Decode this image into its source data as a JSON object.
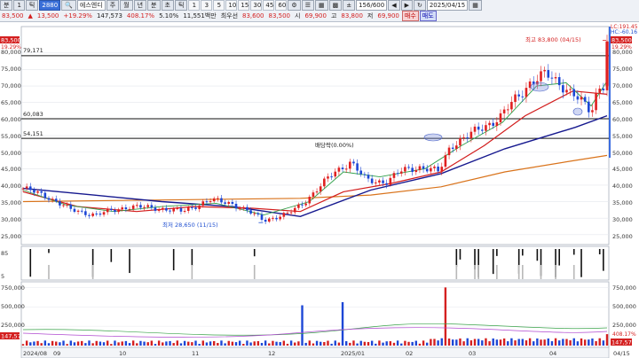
{
  "toolbar": {
    "top": {
      "period_mode": "분",
      "interval": "1",
      "unit": "틱",
      "code": "2880",
      "name": "에스엔디",
      "tabs": [
        "주",
        "월",
        "년",
        "분",
        "초",
        "틱"
      ],
      "numbers": [
        "1",
        "3",
        "5",
        "10",
        "15",
        "30",
        "45",
        "60"
      ],
      "count": "156/600",
      "date": "2025/04/15"
    },
    "quote": {
      "price": "83,500",
      "change": "13,500",
      "change_pct": "+19.29%",
      "volume": "147,573",
      "vol_ratio": "408.17%",
      "turnover": "5.10%",
      "amount": "11,551백만",
      "high_label": "최우선",
      "bid": "83,600",
      "ask": "83,500",
      "open_label": "시",
      "open": "69,900",
      "hi_label": "고",
      "high": "83,800",
      "lo_label": "저",
      "low": "69,900",
      "buy": "매수",
      "sell": "매도"
    }
  },
  "price_axis": {
    "labels": [
      "80,000",
      "75,000",
      "70,000",
      "65,000",
      "60,000",
      "55,000",
      "50,000",
      "45,000",
      "40,000",
      "35,000",
      "30,000",
      "25,000"
    ],
    "left_current": "83,500",
    "left_pct": "19.29%",
    "right_current": "83,500",
    "right_pct": "19.29%",
    "lc_label": "LC:191.45",
    "hc_label": "HC:-60.16"
  },
  "levels": [
    {
      "price": 79171,
      "label": "79,171"
    },
    {
      "price": 60083,
      "label": "60,083"
    },
    {
      "price": 54151,
      "label": "54,151"
    }
  ],
  "annotations": {
    "high": "최고 83,800 (04/15)",
    "low": "최저 28,650 (11/15)",
    "ex_div": "배당락(0.00%)"
  },
  "signal_axis": {
    "labels": [
      "85",
      "5"
    ]
  },
  "volume_axis": {
    "left_labels": [
      "750,000",
      "500,000",
      "250,000",
      "147,573"
    ],
    "right_labels": [
      "750,000",
      "500,000",
      "250,000",
      "408.17%",
      "147,573"
    ]
  },
  "date_axis": [
    "2024/08",
    "09",
    "10",
    "11",
    "12",
    "2025/01",
    "02",
    "03",
    "04",
    "04/15"
  ],
  "chart_data": {
    "type": "candlestick",
    "title": "",
    "xlabel": "",
    "ylabel": "",
    "ylim": [
      22000,
      88000
    ],
    "volume_ylim": [
      0,
      800000
    ],
    "x_range": [
      "2024-08-01",
      "2025-04-15"
    ],
    "current": 83500,
    "high": {
      "date": "2025-04-15",
      "value": 83800
    },
    "low": {
      "date": "2024-11-15",
      "value": 28650
    },
    "close_path": [
      [
        "2024-08-01",
        39000
      ],
      [
        "2024-08-12",
        36500
      ],
      [
        "2024-08-22",
        32500
      ],
      [
        "2024-09-02",
        31000
      ],
      [
        "2024-09-16",
        33500
      ],
      [
        "2024-09-30",
        33000
      ],
      [
        "2024-10-10",
        32000
      ],
      [
        "2024-10-22",
        35500
      ],
      [
        "2024-11-01",
        34500
      ],
      [
        "2024-11-08",
        32000
      ],
      [
        "2024-11-15",
        29500
      ],
      [
        "2024-11-25",
        31000
      ],
      [
        "2024-12-02",
        34500
      ],
      [
        "2024-12-09",
        39000
      ],
      [
        "2024-12-16",
        44000
      ],
      [
        "2024-12-23",
        47000
      ],
      [
        "2024-12-30",
        41500
      ],
      [
        "2025-01-08",
        41000
      ],
      [
        "2025-01-15",
        44500
      ],
      [
        "2025-01-22",
        45500
      ],
      [
        "2025-01-31",
        44000
      ],
      [
        "2025-02-05",
        52000
      ],
      [
        "2025-02-12",
        54500
      ],
      [
        "2025-02-19",
        57500
      ],
      [
        "2025-02-27",
        60500
      ],
      [
        "2025-03-05",
        65500
      ],
      [
        "2025-03-12",
        71000
      ],
      [
        "2025-03-19",
        73500
      ],
      [
        "2025-03-26",
        70500
      ],
      [
        "2025-04-01",
        67000
      ],
      [
        "2025-04-08",
        62000
      ],
      [
        "2025-04-11",
        69500
      ],
      [
        "2025-04-14",
        71000
      ],
      [
        "2025-04-15",
        83500
      ]
    ],
    "ma_fast": [
      [
        "2024-08-01",
        38500
      ],
      [
        "2024-08-20",
        34000
      ],
      [
        "2024-09-10",
        32000
      ],
      [
        "2024-10-01",
        33500
      ],
      [
        "2024-10-25",
        34500
      ],
      [
        "2024-11-15",
        31000
      ],
      [
        "2024-12-05",
        35000
      ],
      [
        "2024-12-20",
        44000
      ],
      [
        "2025-01-05",
        42500
      ],
      [
        "2025-01-25",
        45000
      ],
      [
        "2025-02-10",
        52000
      ],
      [
        "2025-02-28",
        59000
      ],
      [
        "2025-03-15",
        70000
      ],
      [
        "2025-03-28",
        71000
      ],
      [
        "2025-04-08",
        64000
      ],
      [
        "2025-04-15",
        71500
      ]
    ],
    "ma_mid": [
      [
        "2024-08-01",
        38000
      ],
      [
        "2024-08-25",
        33500
      ],
      [
        "2024-09-20",
        32000
      ],
      [
        "2024-10-15",
        33500
      ],
      [
        "2024-11-10",
        33000
      ],
      [
        "2024-12-01",
        32000
      ],
      [
        "2024-12-20",
        38000
      ],
      [
        "2025-01-10",
        40500
      ],
      [
        "2025-02-01",
        44000
      ],
      [
        "2025-02-20",
        52000
      ],
      [
        "2025-03-10",
        61000
      ],
      [
        "2025-03-31",
        68500
      ],
      [
        "2025-04-15",
        67500
      ]
    ],
    "ma_slow": [
      [
        "2024-08-01",
        39000
      ],
      [
        "2024-09-01",
        37000
      ],
      [
        "2024-10-01",
        35000
      ],
      [
        "2024-11-01",
        33500
      ],
      [
        "2024-12-01",
        30500
      ],
      [
        "2025-01-01",
        38500
      ],
      [
        "2025-02-01",
        43500
      ],
      [
        "2025-03-01",
        51000
      ],
      [
        "2025-04-01",
        57500
      ],
      [
        "2025-04-15",
        61000
      ]
    ],
    "ma_long": [
      [
        "2024-08-01",
        35000
      ],
      [
        "2024-10-01",
        35500
      ],
      [
        "2024-12-01",
        36000
      ],
      [
        "2025-01-01",
        37000
      ],
      [
        "2025-02-01",
        39500
      ],
      [
        "2025-03-01",
        44000
      ],
      [
        "2025-04-01",
        47500
      ],
      [
        "2025-04-15",
        49000
      ]
    ],
    "volume_spikes": [
      [
        "2024-12-02",
        520000
      ],
      [
        "2024-12-20",
        560000
      ],
      [
        "2025-02-03",
        750000
      ],
      [
        "2025-04-15",
        147573
      ]
    ]
  }
}
